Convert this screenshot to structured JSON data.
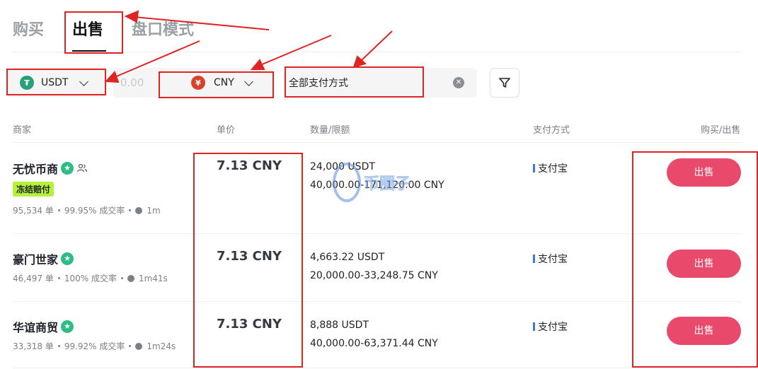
{
  "tabs": [
    {
      "label": "购买"
    },
    {
      "label": "出售"
    },
    {
      "label": "盘口模式"
    }
  ],
  "filters": {
    "coin": {
      "label": "USDT",
      "icon": "tether-icon",
      "color": "#26a17b"
    },
    "amount_placeholder": "0.00",
    "fiat": {
      "label": "CNY",
      "icon": "yuan-icon",
      "color": "#d9412b"
    },
    "payment_method": "全部支付方式"
  },
  "columns": {
    "merchant": "商家",
    "price": "单价",
    "quantity": "数量/限额",
    "payment": "支付方式",
    "action": "购买/出售"
  },
  "rows": [
    {
      "name": "无忧币商",
      "badge": "冻结赔付",
      "orders": "95,534 单",
      "completion": "99.95% 成交率",
      "time": "1m",
      "price": "7.13 CNY",
      "amount": "24,000 USDT",
      "limit": "40,000.00-171,120.00 CNY",
      "payment": "支付宝",
      "action": "出售"
    },
    {
      "name": "豪门世家",
      "orders": "46,497 单",
      "completion": "100% 成交率",
      "time": "1m41s",
      "price": "7.13 CNY",
      "amount": "4,663.22 USDT",
      "limit": "20,000.00-33,248.75 CNY",
      "payment": "支付宝",
      "action": "出售"
    },
    {
      "name": "华谊商贸",
      "orders": "33,318 单",
      "completion": "99.92% 成交率",
      "time": "1m24s",
      "price": "7.13 CNY",
      "amount": "8,888 USDT",
      "limit": "40,000.00-63,371.44 CNY",
      "payment": "支付宝",
      "action": "出售"
    }
  ],
  "watermark": "币圈子",
  "colors": {
    "sell_button": "#e94a6b",
    "annotation": "#e02424",
    "verified": "#2ebd85",
    "badge": "#b7f23b"
  }
}
